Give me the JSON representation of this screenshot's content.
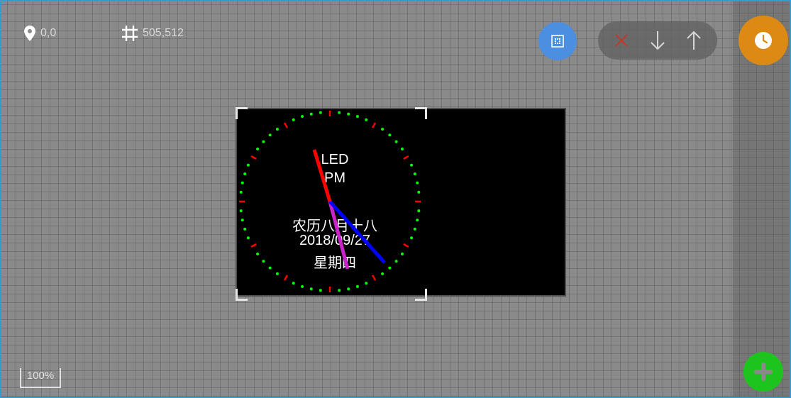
{
  "status": {
    "position_icon": "location-pin-icon",
    "position": "0,0",
    "size_icon": "frame-size-icon",
    "size": "505,512"
  },
  "toolbar": {
    "grid_button_icon": "grid-dots-icon",
    "delete_icon": "close-icon",
    "move_down_icon": "arrow-down-icon",
    "move_up_icon": "arrow-up-icon",
    "clock_button_icon": "clock-icon"
  },
  "clock": {
    "title": "LED",
    "ampm": "PM",
    "lunar_date": "农历八月十八",
    "date": "2018/09/27",
    "weekday": "星期四"
  },
  "zoom": "100%",
  "add_button_icon": "plus-icon",
  "colors": {
    "canvas": "#8a8a8a",
    "grid_button": "#4c8ee0",
    "clock_button": "#dc8a14",
    "add_button": "#1ec41e",
    "hour_hand": "#ff0000",
    "minute_hand": "#0000ff",
    "second_hand": "#cc22cc",
    "dots": "#00ff00",
    "hour_marks": "#ff0000"
  }
}
